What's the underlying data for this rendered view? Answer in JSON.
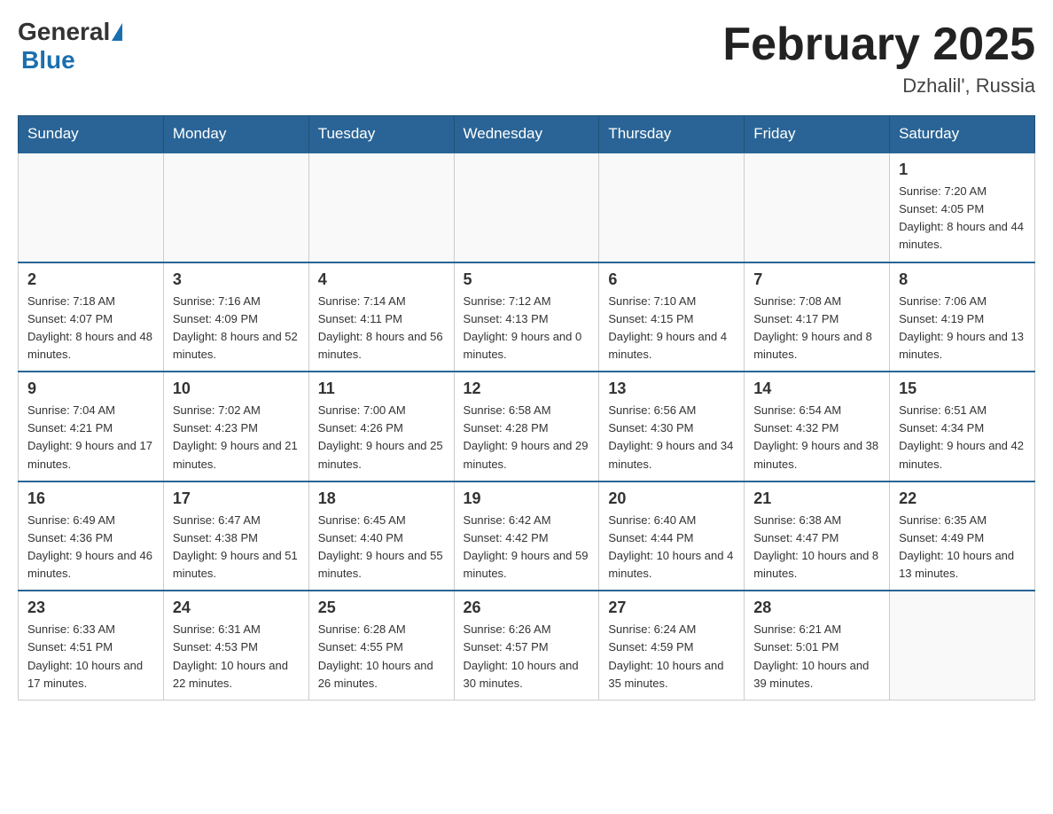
{
  "header": {
    "logo": {
      "general": "General",
      "blue": "Blue"
    },
    "title": "February 2025",
    "location": "Dzhalil', Russia"
  },
  "weekdays": [
    "Sunday",
    "Monday",
    "Tuesday",
    "Wednesday",
    "Thursday",
    "Friday",
    "Saturday"
  ],
  "weeks": [
    [
      {
        "day": "",
        "info": ""
      },
      {
        "day": "",
        "info": ""
      },
      {
        "day": "",
        "info": ""
      },
      {
        "day": "",
        "info": ""
      },
      {
        "day": "",
        "info": ""
      },
      {
        "day": "",
        "info": ""
      },
      {
        "day": "1",
        "info": "Sunrise: 7:20 AM\nSunset: 4:05 PM\nDaylight: 8 hours and 44 minutes."
      }
    ],
    [
      {
        "day": "2",
        "info": "Sunrise: 7:18 AM\nSunset: 4:07 PM\nDaylight: 8 hours and 48 minutes."
      },
      {
        "day": "3",
        "info": "Sunrise: 7:16 AM\nSunset: 4:09 PM\nDaylight: 8 hours and 52 minutes."
      },
      {
        "day": "4",
        "info": "Sunrise: 7:14 AM\nSunset: 4:11 PM\nDaylight: 8 hours and 56 minutes."
      },
      {
        "day": "5",
        "info": "Sunrise: 7:12 AM\nSunset: 4:13 PM\nDaylight: 9 hours and 0 minutes."
      },
      {
        "day": "6",
        "info": "Sunrise: 7:10 AM\nSunset: 4:15 PM\nDaylight: 9 hours and 4 minutes."
      },
      {
        "day": "7",
        "info": "Sunrise: 7:08 AM\nSunset: 4:17 PM\nDaylight: 9 hours and 8 minutes."
      },
      {
        "day": "8",
        "info": "Sunrise: 7:06 AM\nSunset: 4:19 PM\nDaylight: 9 hours and 13 minutes."
      }
    ],
    [
      {
        "day": "9",
        "info": "Sunrise: 7:04 AM\nSunset: 4:21 PM\nDaylight: 9 hours and 17 minutes."
      },
      {
        "day": "10",
        "info": "Sunrise: 7:02 AM\nSunset: 4:23 PM\nDaylight: 9 hours and 21 minutes."
      },
      {
        "day": "11",
        "info": "Sunrise: 7:00 AM\nSunset: 4:26 PM\nDaylight: 9 hours and 25 minutes."
      },
      {
        "day": "12",
        "info": "Sunrise: 6:58 AM\nSunset: 4:28 PM\nDaylight: 9 hours and 29 minutes."
      },
      {
        "day": "13",
        "info": "Sunrise: 6:56 AM\nSunset: 4:30 PM\nDaylight: 9 hours and 34 minutes."
      },
      {
        "day": "14",
        "info": "Sunrise: 6:54 AM\nSunset: 4:32 PM\nDaylight: 9 hours and 38 minutes."
      },
      {
        "day": "15",
        "info": "Sunrise: 6:51 AM\nSunset: 4:34 PM\nDaylight: 9 hours and 42 minutes."
      }
    ],
    [
      {
        "day": "16",
        "info": "Sunrise: 6:49 AM\nSunset: 4:36 PM\nDaylight: 9 hours and 46 minutes."
      },
      {
        "day": "17",
        "info": "Sunrise: 6:47 AM\nSunset: 4:38 PM\nDaylight: 9 hours and 51 minutes."
      },
      {
        "day": "18",
        "info": "Sunrise: 6:45 AM\nSunset: 4:40 PM\nDaylight: 9 hours and 55 minutes."
      },
      {
        "day": "19",
        "info": "Sunrise: 6:42 AM\nSunset: 4:42 PM\nDaylight: 9 hours and 59 minutes."
      },
      {
        "day": "20",
        "info": "Sunrise: 6:40 AM\nSunset: 4:44 PM\nDaylight: 10 hours and 4 minutes."
      },
      {
        "day": "21",
        "info": "Sunrise: 6:38 AM\nSunset: 4:47 PM\nDaylight: 10 hours and 8 minutes."
      },
      {
        "day": "22",
        "info": "Sunrise: 6:35 AM\nSunset: 4:49 PM\nDaylight: 10 hours and 13 minutes."
      }
    ],
    [
      {
        "day": "23",
        "info": "Sunrise: 6:33 AM\nSunset: 4:51 PM\nDaylight: 10 hours and 17 minutes."
      },
      {
        "day": "24",
        "info": "Sunrise: 6:31 AM\nSunset: 4:53 PM\nDaylight: 10 hours and 22 minutes."
      },
      {
        "day": "25",
        "info": "Sunrise: 6:28 AM\nSunset: 4:55 PM\nDaylight: 10 hours and 26 minutes."
      },
      {
        "day": "26",
        "info": "Sunrise: 6:26 AM\nSunset: 4:57 PM\nDaylight: 10 hours and 30 minutes."
      },
      {
        "day": "27",
        "info": "Sunrise: 6:24 AM\nSunset: 4:59 PM\nDaylight: 10 hours and 35 minutes."
      },
      {
        "day": "28",
        "info": "Sunrise: 6:21 AM\nSunset: 5:01 PM\nDaylight: 10 hours and 39 minutes."
      },
      {
        "day": "",
        "info": ""
      }
    ]
  ]
}
